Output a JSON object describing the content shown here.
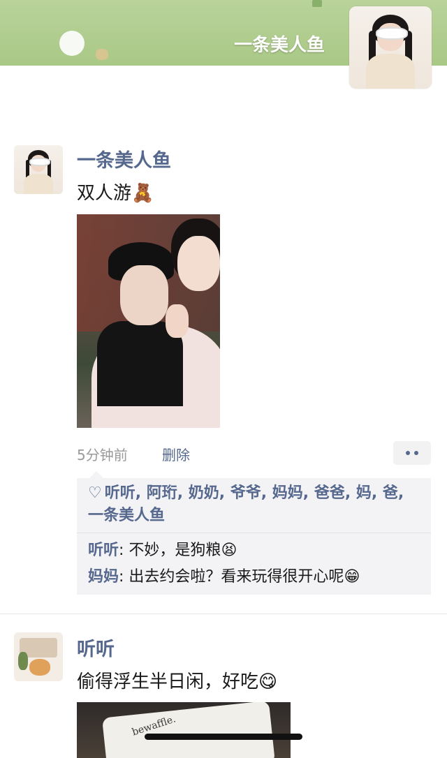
{
  "cover": {
    "name": "一条美人鱼"
  },
  "post1": {
    "username": "一条美人鱼",
    "text": "双人游",
    "text_emoji": "🧸",
    "time": "5分钟前",
    "delete": "删除",
    "likes_icon": "heart-outline-icon",
    "likes": "听听, 阿珩, 奶奶, 爷爷, 妈妈, 爸爸, 妈, 爸, 一条美人鱼",
    "comments": [
      {
        "author": "听听",
        "sep": ": ",
        "text": "不妙，是狗粮",
        "emoji": "😫"
      },
      {
        "author": "妈妈",
        "sep": ": ",
        "text": "出去约会啦？看来玩得很开心呢",
        "emoji": "😁"
      }
    ]
  },
  "post2": {
    "username": "听听",
    "text": "偷得浮生半日闲，好吃",
    "text_emoji": "😋",
    "photo_text": "bewaffle."
  },
  "colors": {
    "link": "#56688e",
    "cover_green": "#b9d39a",
    "interaction_bg": "#f3f3f5"
  }
}
